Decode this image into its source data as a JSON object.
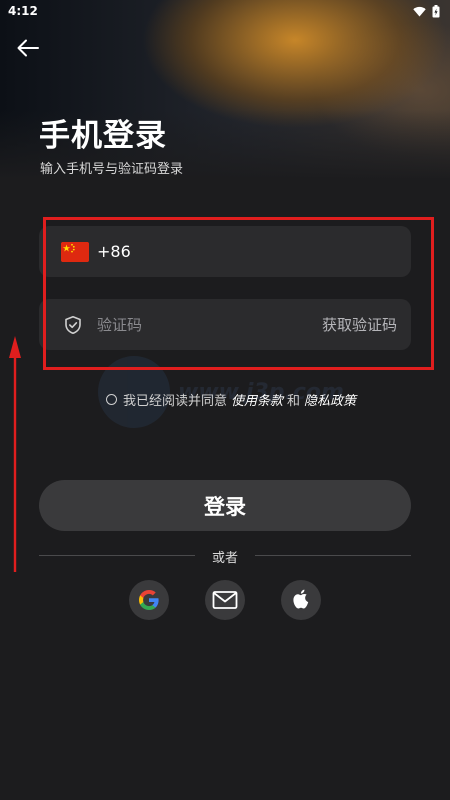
{
  "status_bar": {
    "time": "4:12"
  },
  "header": {
    "title": "手机登录",
    "subtitle": "输入手机号与验证码登录"
  },
  "phone_field": {
    "country_code": "+86"
  },
  "code_field": {
    "placeholder": "验证码",
    "get_code_label": "获取验证码"
  },
  "agreement": {
    "prefix": "我已经阅读并同意",
    "terms_link": "使用条款",
    "connector": "和",
    "privacy_link": "隐私政策"
  },
  "login_button": {
    "label": "登录"
  },
  "divider": {
    "label": "或者"
  },
  "social_logins": [
    {
      "icon": "google-icon"
    },
    {
      "icon": "mail-icon"
    },
    {
      "icon": "apple-icon"
    }
  ],
  "watermark": {
    "text": "www.j3p.com"
  },
  "colors": {
    "background": "#1c1c1e",
    "field": "#2b2b2d",
    "button": "#3a3a3c",
    "annotation_red": "#e01e1e"
  }
}
